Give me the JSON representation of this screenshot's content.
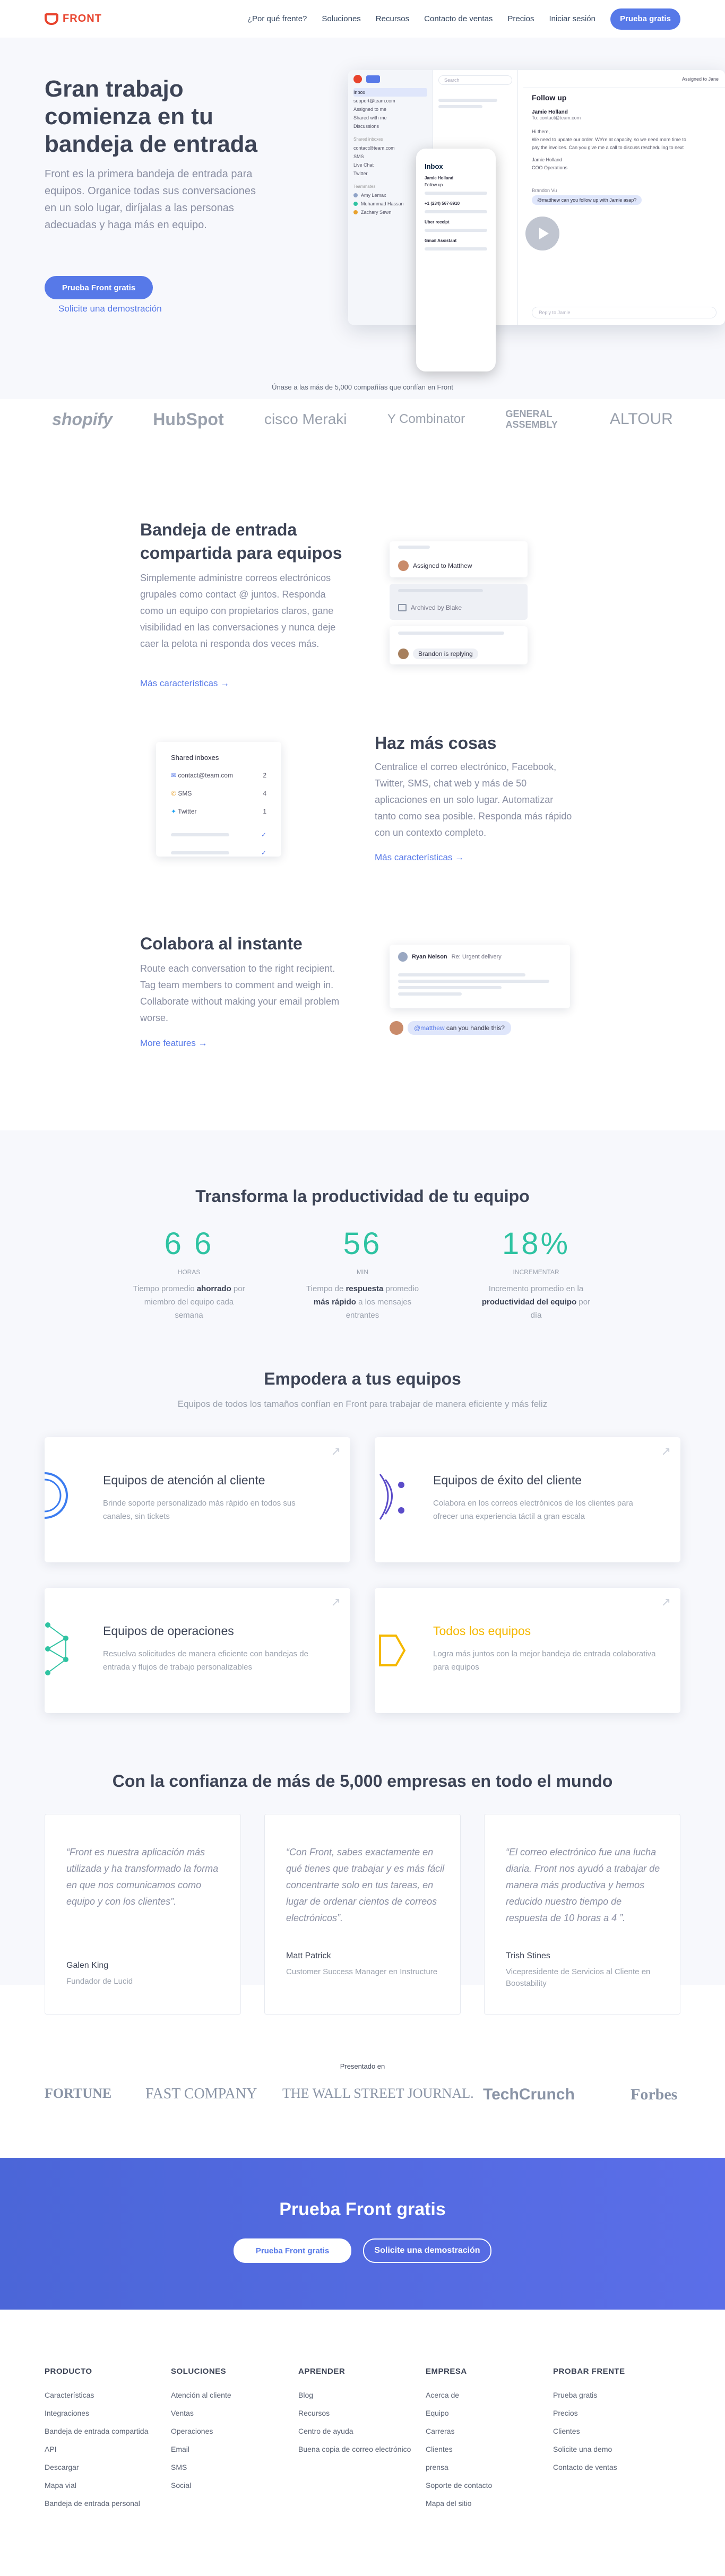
{
  "header": {
    "brand": "FRONT",
    "nav": [
      "¿Por qué frente?",
      "Soluciones",
      "Recursos",
      "Contacto de ventas",
      "Precios",
      "Iniciar sesión"
    ],
    "cta": "Prueba gratis"
  },
  "hero": {
    "title": "Gran trabajo comienza en tu bandeja de entrada",
    "body": "Front es la primera bandeja de entrada para equipos. Organice todas sus conversaciones en un solo lugar, diríjalas a las personas adecuadas y haga más en equipo.",
    "cta": "Prueba Front gratis",
    "demo": "Solicite una demostración",
    "app": {
      "search": "Search",
      "sidebar": [
        "Inbox",
        "support@team.com",
        "Assigned to me",
        "Shared with me",
        "Discussions"
      ],
      "sidebar_h2": "Shared inboxes",
      "sidebar2": [
        "contact@team.com",
        "SMS",
        "Live Chat",
        "Twitter"
      ],
      "sidebar_h3": "Teammates",
      "sidebar3": [
        "Amy Lemax",
        "Muhammad Hassan",
        "Zachary Sewn"
      ],
      "mail_title": "Follow up",
      "mail_from": "Jamie Holland",
      "mail_to": "To: contact@team.com",
      "mail_lines": [
        "Hi there,",
        "We need to update our order. We're at capacity, so we need more time to",
        "pay the invoices. Can you give me a call to discuss rescheduling to next",
        "Jamie Holland",
        "COO Operations"
      ],
      "mention_name": "Brandon Vu",
      "mention": "@matthew can you follow up with Jamie asap?",
      "assigned": "Assigned to Jane",
      "phone_title": "Inbox",
      "phone_items": [
        "Jamie Holland",
        "Follow up",
        "+1 (234) 567-8910",
        "Uber receipt",
        "Gmail Assistant"
      ],
      "reply_ph": "Reply to Jamie"
    }
  },
  "trust": {
    "caption": "Únase a las más de 5,000 compañías que confían en Front",
    "logos": [
      "shopify",
      "HubSpot",
      "cisco Meraki",
      "Y Combinator",
      "GENERAL ASSEMBLY",
      "ALTOUR"
    ]
  },
  "features": [
    {
      "title": "Bandeja de entrada compartida para equipos",
      "body": "Simplemente administre correos electrónicos grupales como contact @ juntos. Responda como un equipo con propietarios claros, gane visibilidad en las conversaciones y nunca deje caer la pelota ni responda dos veces más.",
      "link": "Más características →",
      "mock": [
        "Assigned to Matthew",
        "Archived by Blake",
        "Brandon is replying"
      ]
    },
    {
      "title": "Haz más cosas",
      "body": "Centralice el correo electrónico, Facebook, Twitter, SMS, chat web y más de 50 aplicaciones en un solo lugar. Automatizar tanto como sea posible. Responda más rápido con un contexto completo.",
      "link": "Más características →",
      "mock": {
        "title": "Shared inboxes",
        "items": [
          "contact@team.com",
          "SMS",
          "Twitter"
        ],
        "counts": [
          "2",
          "4",
          "1"
        ]
      }
    },
    {
      "title": "Colabora al instante",
      "body": "Route each conversation to the right recipient. Tag team members to comment and weigh in. Collaborate without making your email problem worse.",
      "link": "More features →",
      "mock": {
        "from": "Ryan Nelson",
        "subject": "Re: Urgent delivery",
        "mention_tag": "@matthew",
        "mention": "can you handle this?"
      }
    }
  ],
  "productivity": {
    "title": "Transforma la productividad de tu equipo",
    "stats": [
      {
        "value": "6 6",
        "unit": "Horas",
        "desc_pre": "Tiempo promedio ",
        "desc_bold": "ahorrado",
        "desc_post": " por miembro del equipo cada semana"
      },
      {
        "value": "56",
        "unit": "MIN",
        "desc_pre": "Tiempo de ",
        "desc_bold": "respuesta",
        "desc_mid": " promedio ",
        "desc_bold2": "más rápido",
        "desc_post": " a los mensajes entrantes"
      },
      {
        "value": "18%",
        "unit": "INCREMENTAR",
        "desc_pre": "Incremento promedio en la ",
        "desc_bold": "productividad del equipo",
        "desc_post": " por día"
      }
    ]
  },
  "empower": {
    "title": "Empodera a tus equipos",
    "subtitle": "Equipos de todos los tamaños confían en Front para trabajar de manera eficiente y más feliz",
    "cards": [
      {
        "title": "Equipos de atención al cliente",
        "body": "Brinde soporte personalizado más rápido en todos sus canales, sin tickets",
        "color": "#3b7cf0"
      },
      {
        "title": "Equipos de éxito del cliente",
        "body": "Colabora en los correos electrónicos de los clientes para ofrecer una experiencia táctil a gran escala",
        "color": "#5b4cc9"
      },
      {
        "title": "Equipos de operaciones",
        "body": "Resuelva solicitudes de manera eficiente con bandejas de entrada y flujos de trabajo personalizables",
        "color": "#2fc3a2"
      },
      {
        "title": "Todos los equipos",
        "body": "Logra más juntos con la mejor bandeja de entrada colaborativa para equipos",
        "color": "#f5b800"
      }
    ]
  },
  "testimonials": {
    "title": "Con la confianza de más de 5,000 empresas en todo el mundo",
    "items": [
      {
        "quote": "“Front es nuestra aplicación más utilizada y ha transformado la forma en que nos comunicamos como equipo y con los clientes”.",
        "name": "Galen King",
        "role": "Fundador de Lucid"
      },
      {
        "quote": "“Con Front, sabes exactamente en qué tienes que trabajar y es más fácil concentrarte solo en tus tareas, en lugar de ordenar cientos de correos electrónicos”.",
        "name": "Matt Patrick",
        "role": "Customer Success Manager en Instructure"
      },
      {
        "quote": "“El correo electrónico fue una lucha diaria. Front nos ayudó a trabajar de manera más productiva y hemos reducido nuestro tiempo de respuesta de 10 horas a 4 ”.",
        "name": "Trish Stines",
        "role": "Vicepresidente de Servicios al Cliente en Boostability"
      }
    ]
  },
  "press": {
    "caption": "Presentado en",
    "logos": [
      "FORTUNE",
      "FAST COMPANY",
      "THE WALL STREET JOURNAL.",
      "TechCrunch",
      "Forbes"
    ]
  },
  "band": {
    "title": "Prueba Front gratis",
    "cta": "Prueba Front gratis",
    "demo": "Solicite una demostración"
  },
  "footer": [
    {
      "h": "PRODUCTO",
      "links": [
        "Características",
        "Integraciones",
        "Bandeja de entrada compartida",
        "API",
        "Descargar",
        "Mapa vial",
        "Bandeja de entrada personal"
      ]
    },
    {
      "h": "SOLUCIONES",
      "links": [
        "Atención al cliente",
        "Ventas",
        "Operaciones",
        "Email",
        "SMS",
        "Social"
      ]
    },
    {
      "h": "APRENDER",
      "links": [
        "Blog",
        "Recursos",
        "Centro de ayuda",
        "Buena copia de correo electrónico"
      ]
    },
    {
      "h": "EMPRESA",
      "links": [
        "Acerca de",
        "Equipo",
        "Carreras",
        "Clientes",
        "prensa",
        "Soporte de contacto",
        "Mapa del sitio"
      ]
    },
    {
      "h": "PROBAR FRENTE",
      "links": [
        "Prueba gratis",
        "Precios",
        "Clientes",
        "Solicite una demo",
        "Contacto de ventas"
      ]
    }
  ]
}
